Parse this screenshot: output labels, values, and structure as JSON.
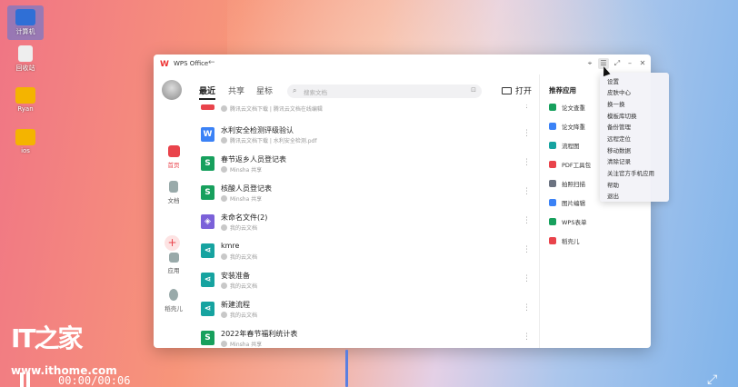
{
  "desktop": {
    "icons": [
      {
        "label": "计算机",
        "glyph_color": "#2f6fd6"
      },
      {
        "label": "回收站",
        "glyph_color": "#eeeeee"
      },
      {
        "label": "Ryan",
        "glyph_color": "#f4b400"
      },
      {
        "label": "ios",
        "glyph_color": "#f4b400"
      }
    ]
  },
  "window": {
    "app_title": "WPS Office",
    "back_symbol": "←",
    "controls": [
      "⌖",
      "☰",
      "⤢",
      "–",
      "✕"
    ]
  },
  "leftnav": {
    "items": [
      {
        "label": "首页",
        "icon": "home-icon"
      },
      {
        "label": "文档",
        "icon": "document-icon"
      },
      {
        "label": "应用",
        "icon": "apps-icon"
      },
      {
        "label": "稻壳儿",
        "icon": "docer-icon"
      }
    ],
    "plus": "+"
  },
  "tabs": [
    "最近",
    "共享",
    "星标"
  ],
  "search": {
    "placeholder": "搜索文档",
    "scan": "⊡"
  },
  "open_button": "打开",
  "files": [
    {
      "name": "",
      "meta": "腾讯云文档下载 | 腾讯云文档在线编辑",
      "type": "P",
      "color": "#e9434b"
    },
    {
      "name": "水利安全检测评级验认",
      "meta": "腾讯云文档下载 | 水利安全检测.pdf",
      "type": "W",
      "color": "#3b82f6"
    },
    {
      "name": "春节返乡人员登记表",
      "meta": "Minsha 共享",
      "type": "S",
      "color": "#17a05d"
    },
    {
      "name": "核酸人员登记表",
      "meta": "Minsha 共享",
      "type": "S",
      "color": "#17a05d"
    },
    {
      "name": "未命名文件(2)",
      "meta": "我的云文档",
      "type": "◈",
      "color": "#7b61d9"
    },
    {
      "name": "kmre",
      "meta": "我的云文档",
      "type": "⋖",
      "color": "#16a3a0"
    },
    {
      "name": "安装准备",
      "meta": "我的云文档",
      "type": "⋖",
      "color": "#16a3a0"
    },
    {
      "name": "新建流程",
      "meta": "我的云文档",
      "type": "⋖",
      "color": "#16a3a0"
    },
    {
      "name": "2022年春节福利统计表",
      "meta": "Minsha 共享",
      "type": "S",
      "color": "#17a05d"
    }
  ],
  "more_symbol": "⋮",
  "recommended": {
    "title": "推荐应用",
    "items": [
      {
        "label": "论文查重",
        "color": "#17a05d"
      },
      {
        "label": "论文降重",
        "color": "#3b82f6"
      },
      {
        "label": "流程图",
        "color": "#16a3a0"
      },
      {
        "label": "PDF工具包",
        "color": "#e9434b"
      },
      {
        "label": "拍照扫描",
        "color": "#6b7280"
      },
      {
        "label": "图片编辑",
        "color": "#3b82f6"
      },
      {
        "label": "WPS表单",
        "color": "#17a05d"
      },
      {
        "label": "稻壳儿",
        "color": "#e9434b"
      }
    ]
  },
  "menu": {
    "items": [
      "设置",
      "皮肤中心",
      "换一换",
      "模板库切换",
      "备份管理",
      "远程定位",
      "移动数据",
      "清除记录",
      "关注官方手机应用",
      "帮助",
      "退出"
    ]
  },
  "watermark": {
    "logo": "IT之家",
    "url": "www.ithome.com"
  },
  "video": {
    "time": "00:00/00:06",
    "fullscreen": "⤢"
  }
}
